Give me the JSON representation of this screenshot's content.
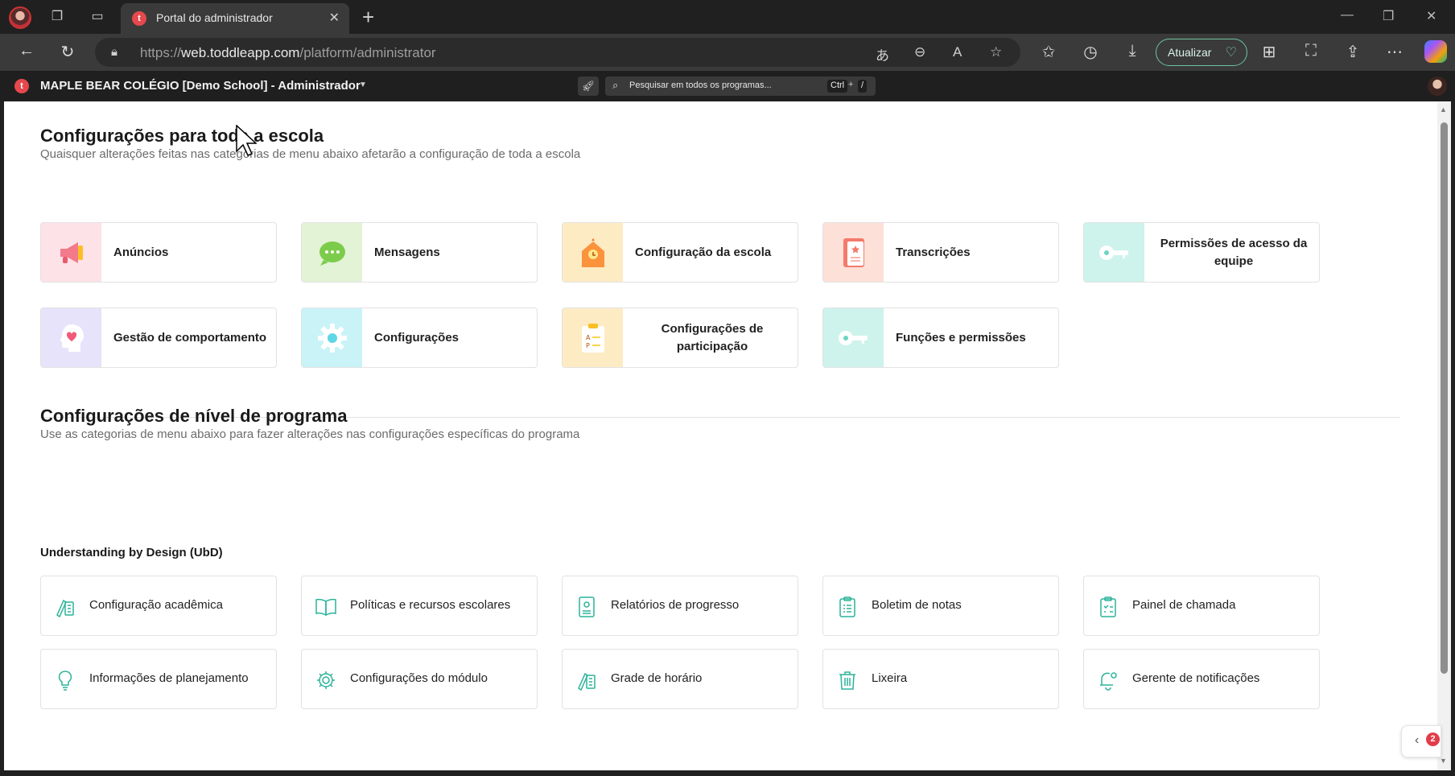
{
  "browser": {
    "tab_title": "Portal do administrador",
    "tab_favicon": "t",
    "url_prefix": "https://",
    "url_domain": "web.toddleapp.com",
    "url_path": "/platform/administrator",
    "update_label": "Atualizar"
  },
  "app": {
    "logo_letter": "t",
    "title": "MAPLE BEAR COLÉGIO [Demo School] - Administrador",
    "search_placeholder": "Pesquisar em todos os programas...",
    "shortcut_ctrl": "Ctrl",
    "shortcut_plus": "+",
    "shortcut_key": "/"
  },
  "school_section": {
    "title": "Configurações para toda a escola",
    "subtitle": "Quaisquer alterações feitas nas categorias de menu abaixo afetarão a configuração de toda a escola",
    "cards": [
      {
        "label": "Anúncios",
        "icon": "megaphone-icon",
        "bg": "#fde2e8"
      },
      {
        "label": "Mensagens",
        "icon": "chat-bubble-icon",
        "bg": "#e3f3d6"
      },
      {
        "label": "Configuração da escola",
        "icon": "school-building-icon",
        "bg": "#fdebc4"
      },
      {
        "label": "Transcrições",
        "icon": "document-star-icon",
        "bg": "#fde0d8"
      },
      {
        "label": "Permissões de acesso da equipe",
        "icon": "key-icon",
        "bg": "#cdf3ec"
      },
      {
        "label": "Gestão de comportamento",
        "icon": "head-heart-icon",
        "bg": "#e6e3fb"
      },
      {
        "label": "Configurações",
        "icon": "gear-icon",
        "bg": "#c9f3f6"
      },
      {
        "label": "Configurações de participação",
        "icon": "attendance-clipboard-icon",
        "bg": "#fdebc4"
      },
      {
        "label": "Funções e permissões",
        "icon": "key-icon",
        "bg": "#cdf3ec"
      }
    ]
  },
  "program_section": {
    "title": "Configurações de nível de programa",
    "subtitle": "Use as categorias de menu abaixo para fazer alterações nas configurações específicas do programa",
    "program_name": "Understanding by Design (UbD)",
    "cards": [
      {
        "label": "Configuração acadêmica",
        "icon": "academic-tools-icon"
      },
      {
        "label": "Políticas e recursos escolares",
        "icon": "book-icon"
      },
      {
        "label": "Relatórios de progresso",
        "icon": "report-icon"
      },
      {
        "label": "Boletim de notas",
        "icon": "clipboard-list-icon"
      },
      {
        "label": "Painel de chamada",
        "icon": "checklist-icon"
      },
      {
        "label": "Informações de planejamento",
        "icon": "lightbulb-icon"
      },
      {
        "label": "Configurações do módulo",
        "icon": "gear-outline-icon"
      },
      {
        "label": "Grade de horário",
        "icon": "timetable-icon"
      },
      {
        "label": "Lixeira",
        "icon": "trash-icon"
      },
      {
        "label": "Gerente de notificações",
        "icon": "bell-gear-icon"
      }
    ]
  },
  "help_widget": {
    "badge_count": "2"
  },
  "colors": {
    "accent": "#2bb39a",
    "brand": "#e5484d"
  }
}
